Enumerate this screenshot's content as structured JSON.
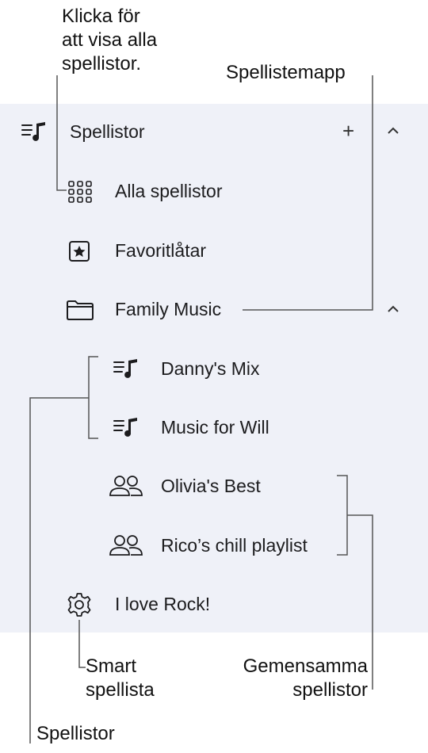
{
  "callouts": {
    "view_all": [
      "Klicka för",
      "att visa alla",
      "spellistor."
    ],
    "folder": "Spellistemapp",
    "smart": [
      "Smart",
      "spellista"
    ],
    "shared": [
      "Gemensamma",
      "spellistor"
    ],
    "playlists": "Spellistor"
  },
  "sidebar": {
    "section_title": "Spellistor",
    "add_symbol": "+",
    "collapse_symbol": "^",
    "items": [
      {
        "label": "Alla spellistor",
        "icon": "grid-icon"
      },
      {
        "label": "Favoritlåtar",
        "icon": "star-square-icon"
      },
      {
        "label": "Family Music",
        "icon": "folder-icon"
      },
      {
        "label": "Danny's Mix",
        "icon": "playlist-icon"
      },
      {
        "label": "Music for Will",
        "icon": "playlist-icon"
      },
      {
        "label": "Olivia's Best",
        "icon": "shared-people-icon"
      },
      {
        "label": "Rico’s chill playlist",
        "icon": "shared-people-icon"
      },
      {
        "label": "I love Rock!",
        "icon": "gear-icon"
      }
    ]
  }
}
